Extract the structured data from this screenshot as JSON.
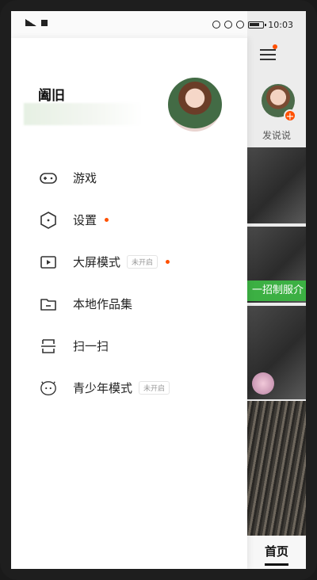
{
  "status_bar": {
    "time": "10:03"
  },
  "drawer": {
    "user_name": "阖旧",
    "menu": [
      {
        "label": "游戏",
        "icon": "gamepad-icon"
      },
      {
        "label": "设置",
        "icon": "hexagon-settings-icon",
        "dot": true
      },
      {
        "label": "大屏模式",
        "icon": "play-screen-icon",
        "tag": "未开启",
        "dot": true
      },
      {
        "label": "本地作品集",
        "icon": "folder-icon"
      },
      {
        "label": "扫一扫",
        "icon": "scan-icon"
      },
      {
        "label": "青少年模式",
        "icon": "teen-mode-icon",
        "tag": "未开启"
      }
    ]
  },
  "feed": {
    "post_label": "发说说",
    "banner_text": "一招制服介",
    "bottom_tab": "首页"
  },
  "colors": {
    "accent": "#ff5000",
    "green_banner": "#3cb043"
  }
}
